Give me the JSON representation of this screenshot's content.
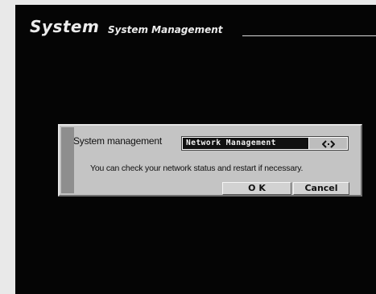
{
  "header": {
    "title": "System",
    "subtitle": "System Management"
  },
  "dialog": {
    "label": "System management",
    "dropdown": {
      "value": "Network Management",
      "button_icon": "dropdown-arrows-icon"
    },
    "message": "You can check your network status and restart if necessary.",
    "buttons": {
      "ok": "O K",
      "cancel": "Cancel"
    }
  },
  "colors": {
    "screen_bg": "#050505",
    "frame_bg": "#e9e9e9",
    "dialog_bg": "#c4c4c4",
    "dialog_sidebar": "#8e8e8e"
  }
}
